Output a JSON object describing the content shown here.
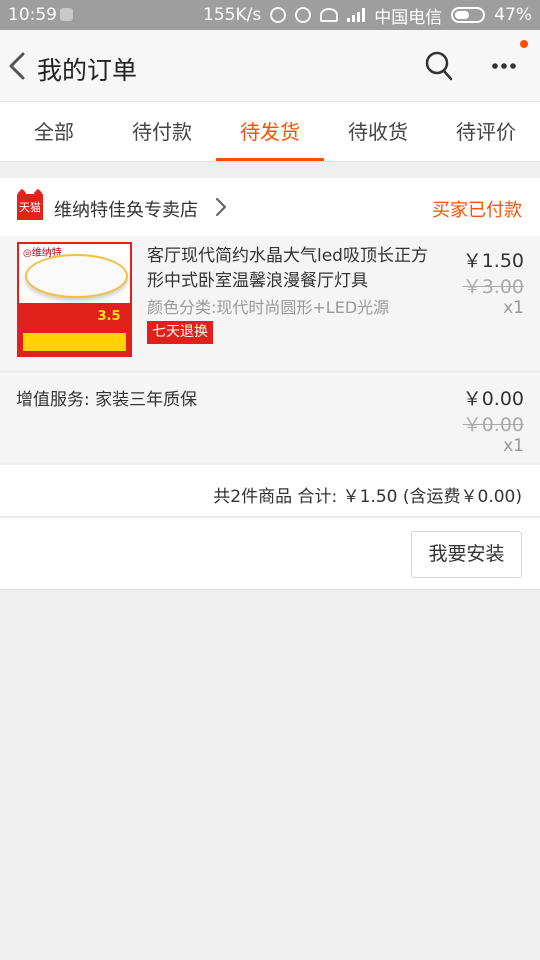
{
  "status_bar": {
    "time": "10:59",
    "speed": "155K/s",
    "carrier": "中国电信",
    "battery": "47%"
  },
  "header": {
    "title": "我的订单"
  },
  "tabs": [
    {
      "label": "全部"
    },
    {
      "label": "待付款"
    },
    {
      "label": "待发货",
      "active": true
    },
    {
      "label": "待收货"
    },
    {
      "label": "待评价"
    }
  ],
  "shop": {
    "logo_text": "天猫",
    "name": "维纳特佳奂专卖店",
    "status": "买家已付款"
  },
  "item": {
    "thumb_brand": "◎维纳特",
    "thumb_badge": "3.5",
    "title": "客厅现代简约水晶大气led吸顶长正方形中式卧室温馨浪漫餐厅灯具",
    "sku": "颜色分类:现代时尚圆形+LED光源",
    "tag": "七天退换",
    "price": "￥1.50",
    "original_price": "￥3.00",
    "quantity": "x1"
  },
  "service": {
    "label": "增值服务: 家装三年质保",
    "price": "￥0.00",
    "original_price": "￥0.00",
    "quantity": "x1"
  },
  "summary": {
    "text": "共2件商品   合计: ￥1.50 (含运费￥0.00)"
  },
  "actions": {
    "install_label": "我要安装"
  },
  "colors": {
    "accent": "#ff5000",
    "tag_red": "#e0201b"
  }
}
